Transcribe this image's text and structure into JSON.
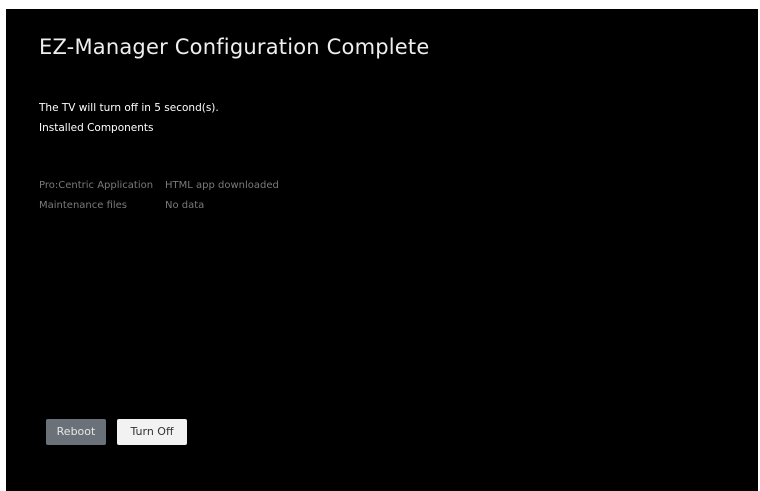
{
  "title": "EZ-Manager Configuration Complete",
  "countdown_text": "The TV will turn off in 5 second(s).",
  "installed_heading": "Installed Components",
  "components": [
    {
      "name": "Pro:Centric Application",
      "status": "HTML app downloaded"
    },
    {
      "name": "Maintenance files",
      "status": "No data"
    }
  ],
  "buttons": {
    "reboot_label": "Reboot",
    "turn_off_label": "Turn Off"
  },
  "colors": {
    "background": "#000000",
    "muted_text": "#7a7a7a",
    "reboot_button": "#6b7178",
    "turn_off_button": "#f2f2f2"
  }
}
